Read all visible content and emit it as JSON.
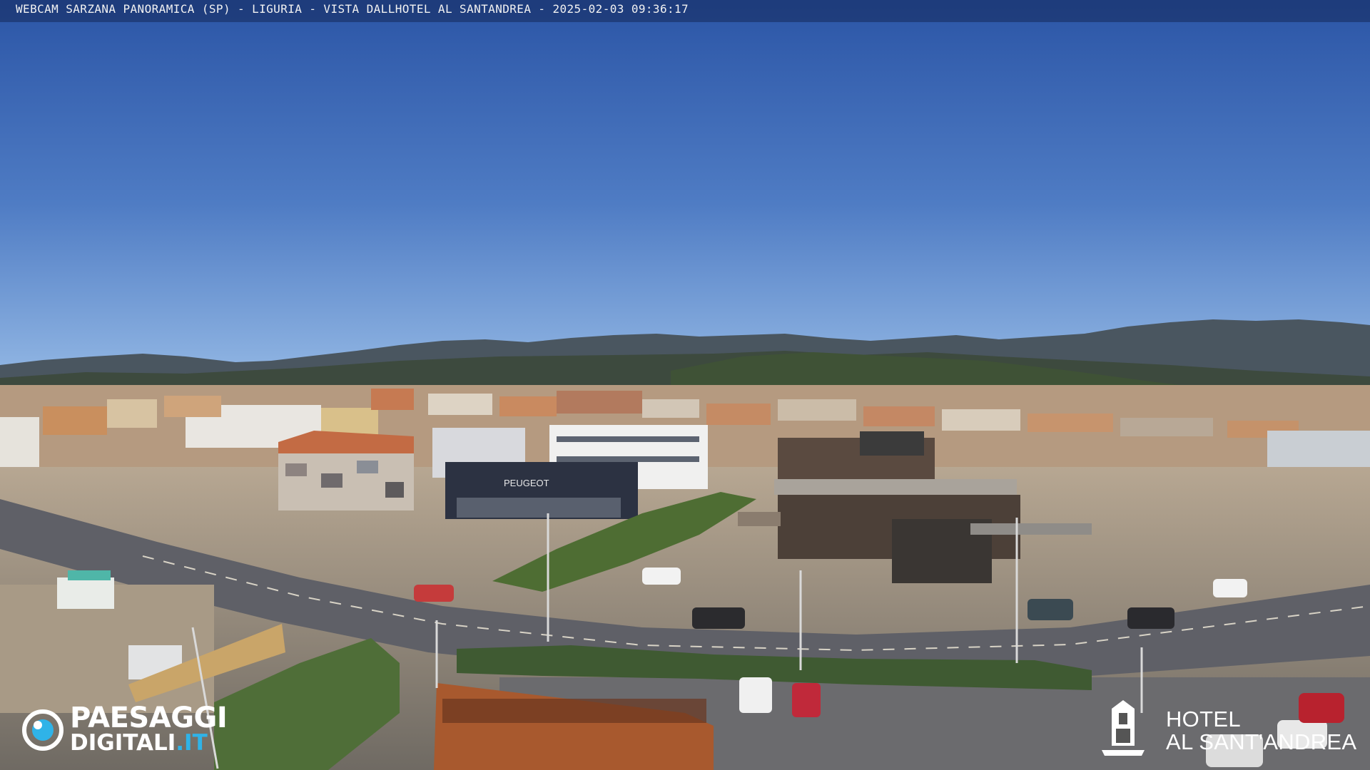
{
  "overlay": {
    "title": "WEBCAM SARZANA PANORAMICA (SP) - LIGURIA - VISTA DALLHOTEL AL SANTANDREA - 2025-02-03  09:36:17"
  },
  "logos": {
    "left": {
      "line1": "PAESAGGI",
      "line2_main": "DIGITALI",
      "line2_suffix": ".IT"
    },
    "right": {
      "line1": "HOTEL",
      "line2": "AL SANT'ANDREA"
    }
  },
  "signage": {
    "dealership": "PEUGEOT"
  },
  "colors": {
    "sky_top": "#2b55a6",
    "sky_horizon": "#86aee0",
    "mountains": "#3e4a52",
    "accent_logo": "#2fb3e8"
  }
}
